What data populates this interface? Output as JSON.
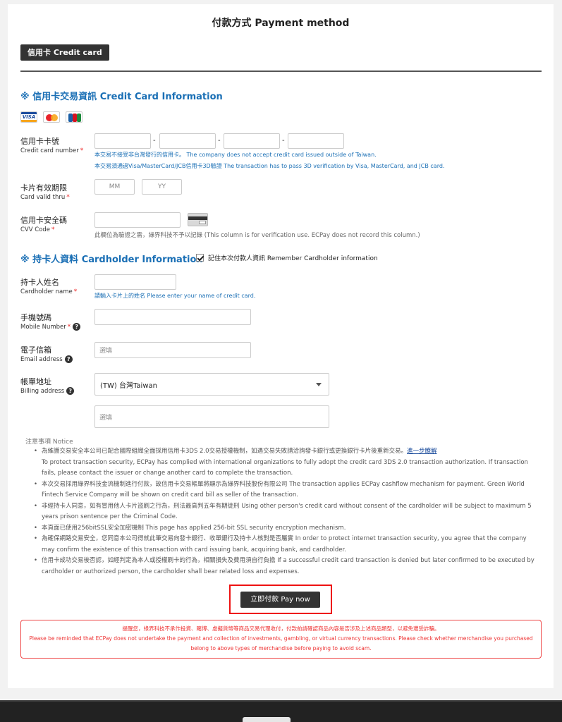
{
  "page": {
    "title": "付款方式 Payment method",
    "tab_label": "信用卡 Credit card"
  },
  "card_section": {
    "title": "※ 信用卡交易資訊 Credit Card Information",
    "logos": [
      "VISA",
      "MasterCard",
      "JCB"
    ]
  },
  "fields": {
    "card_number": {
      "label_zh": "信用卡卡號",
      "label_en": "Credit card number",
      "hint1": "本交易不接受非台灣發行的信用卡。 The company does not accept credit card issued outside of Taiwan.",
      "hint2": "本交易須通過Visa/MasterCard/JCB信用卡3D驗證 The transaction has to pass 3D verification by Visa, MasterCard, and JCB card."
    },
    "valid_thru": {
      "label_zh": "卡片有效期限",
      "label_en": "Card valid thru",
      "mm_placeholder": "MM",
      "yy_placeholder": "YY"
    },
    "cvv": {
      "label_zh": "信用卡安全碼",
      "label_en": "CVV Code",
      "hint": "此欄位為驗證之需，綠界科技不予以記錄 (This column is for verification use. ECPay does not record this column.)"
    }
  },
  "holder_section": {
    "title": "※ 持卡人資料 Cardholder Information",
    "remember_label": "記住本次付款人資訊 Remember Cardholder information",
    "name": {
      "label_zh": "持卡人姓名",
      "label_en": "Cardholder name",
      "hint": "請輸入卡片上的姓名 Please enter your name of credit card."
    },
    "mobile": {
      "label_zh": "手機號碼",
      "label_en": "Mobile Number"
    },
    "email": {
      "label_zh": "電子信箱",
      "label_en": "Email address",
      "placeholder": "選填"
    },
    "billing": {
      "label_zh": "帳單地址",
      "label_en": "Billing address",
      "country": "(TW) 台灣Taiwan",
      "placeholder": "選填"
    }
  },
  "notice": {
    "title": "注意事項 Notice",
    "items": [
      {
        "text": "為維護交易安全本公司已配合國際組織全面採用信用卡3DS 2.0交易授權機制，如遇交易失敗請洽詢發卡銀行或更換銀行卡片後重新交易。",
        "link": "進一步瞭解",
        "text_en": "To protect transaction security, ECPay has complied with international organizations to fully adopt the credit card 3DS 2.0 transaction authorization. If transaction fails, please contact the issuer or change another card to complete the transaction."
      },
      {
        "text": "本次交易採用綠界科技金流機制進行付款，故信用卡交易帳單將顯示為綠界科技股份有限公司 The transaction applies ECPay cashflow mechanism for payment. Green World Fintech Service Company will be shown on credit card bill as seller of the transaction."
      },
      {
        "text": "非經持卡人同意，如有冒用他人卡片盜刷之行為，刑法最高判五年有期徒刑 Using other person's credit card without consent of the cardholder will be subject to maximum 5 years prison sentence per the Criminal Code."
      },
      {
        "text": "本頁面已使用256bitSSL安全加密機制 This page has applied 256-bit SSL security encryption mechanism."
      },
      {
        "text": "為確保網路交易安全，您同意本公司得就此筆交易向發卡銀行、收單銀行及持卡人核對是否屬實 In order to protect internet transaction security, you agree that the company may confirm the existence of this transaction with card issuing bank, acquiring bank, and cardholder."
      },
      {
        "text": "信用卡成功交易後否認，如經判定為本人或授權刷卡的行為，相關損失及費用須自行負擔 If a successful credit card transaction is denied but later confirmed to be executed by cardholder or authorized person, the cardholder shall bear related loss and expenses."
      }
    ]
  },
  "pay_button": "立即付款 Pay now",
  "warning": {
    "line1": "提醒您，綠界科技不承作投資、賭博、虛擬貨幣等商品交易代理收付，付款前請確認商品內容是否涉及上述商品類型，以避免遭受詐騙。",
    "line2": "Please be reminded that ECPay does not undertake the payment and collection of investments, gambling, or virtual currency transactions. Please check whether merchandise you purchased",
    "line3": "belong to above types of merchandise before paying to avoid scam."
  },
  "colors": {
    "accent_blue": "#1a6fb5",
    "required_red": "#e22222",
    "button_dark": "#333333",
    "highlight_red": "#ee1111"
  }
}
